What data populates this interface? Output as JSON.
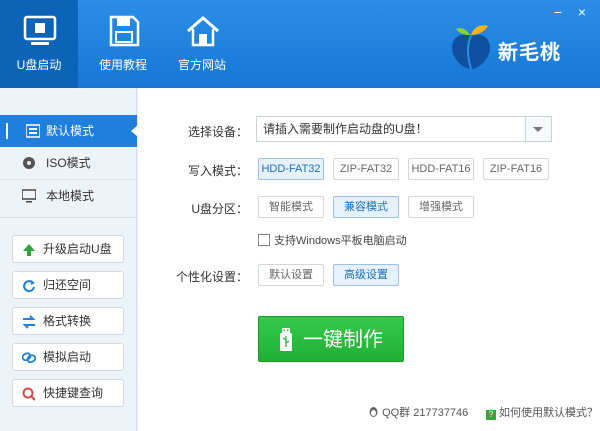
{
  "top_nav": {
    "usb_boot": "U盘启动",
    "tutorial": "使用教程",
    "website": "官方网站"
  },
  "brand": {
    "name": "新毛桃"
  },
  "window": {
    "minimize": "−",
    "close": "×"
  },
  "sidebar": {
    "modes": [
      "默认模式",
      "ISO模式",
      "本地模式"
    ],
    "tools": [
      "升级启动U盘",
      "归还空间",
      "格式转换",
      "模拟启动",
      "快捷键查询"
    ]
  },
  "form": {
    "device_label": "选择设备：",
    "device_value": "请插入需要制作启动盘的U盘！",
    "write_mode_label": "写入模式：",
    "write_modes": [
      "HDD-FAT32",
      "ZIP-FAT32",
      "HDD-FAT16",
      "ZIP-FAT16"
    ],
    "partition_label": "U盘分区：",
    "partitions": [
      "智能模式",
      "兼容模式",
      "增强模式"
    ],
    "tablet_checkbox": "支持Windows平板电脑启动",
    "personal_label": "个性化设置：",
    "personal_options": [
      "默认设置",
      "高级设置"
    ],
    "make_button": "一键制作"
  },
  "footer": {
    "qq": "QQ群 217737746",
    "help": "如何使用默认模式？"
  },
  "colors": {
    "header": "#1677d6",
    "accent": "#1e7fdc",
    "make_button": "#22b238"
  }
}
